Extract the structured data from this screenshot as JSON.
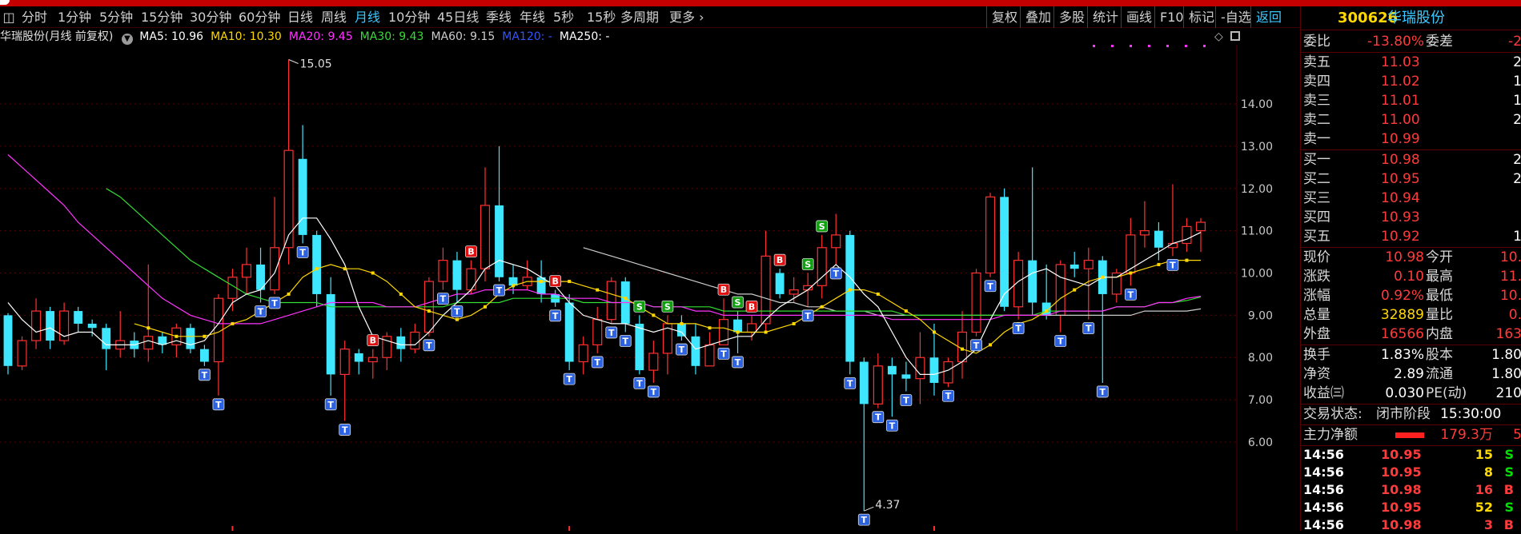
{
  "toolbar": {
    "tabs": [
      {
        "label": "分时",
        "active": false
      },
      {
        "label": "1分钟",
        "active": false
      },
      {
        "label": "5分钟",
        "active": false
      },
      {
        "label": "15分钟",
        "active": false
      },
      {
        "label": "30分钟",
        "active": false
      },
      {
        "label": "60分钟",
        "active": false
      },
      {
        "label": "日线",
        "active": false
      },
      {
        "label": "周线",
        "active": false
      },
      {
        "label": "月线",
        "active": true
      },
      {
        "label": "10分钟",
        "active": false
      },
      {
        "label": "45日线",
        "active": false
      },
      {
        "label": "季线",
        "active": false
      },
      {
        "label": "年线",
        "active": false
      },
      {
        "label": "5秒",
        "active": false
      },
      {
        "label": "15秒",
        "active": false
      },
      {
        "label": "多周期",
        "active": false
      },
      {
        "label": "更多",
        "active": false
      }
    ],
    "right_buttons": [
      "复权",
      "叠加",
      "多股",
      "统计",
      "画线",
      "F10",
      "标记",
      "-自选",
      "返回"
    ]
  },
  "ma_legend": {
    "title": "华瑞股份(月线 前复权)",
    "items": [
      {
        "label": "MA5: 10.96",
        "color": "#ffffff"
      },
      {
        "label": "MA10: 10.30",
        "color": "#ffd800"
      },
      {
        "label": "MA20: 9.45",
        "color": "#ff33ff"
      },
      {
        "label": "MA30: 9.43",
        "color": "#33dd33"
      },
      {
        "label": "MA60: 9.15",
        "color": "#cccccc"
      },
      {
        "label": "MA120: -",
        "color": "#3355ff"
      },
      {
        "label": "MA250: -",
        "color": "#ffffff"
      }
    ]
  },
  "chart_data": {
    "type": "candlestick",
    "ylim": [
      3.9,
      15.4
    ],
    "y_ticks": [
      "14.00",
      "13.00",
      "12.00",
      "11.00",
      "10.00",
      "9.00",
      "8.00",
      "7.00",
      "6.00"
    ],
    "y_tick_values": [
      14,
      13,
      12,
      11,
      10,
      9,
      8,
      7,
      6
    ],
    "high_label": "15.05",
    "high_value": 15.05,
    "high_index": 20,
    "low_label": "4.37",
    "low_value": 4.37,
    "low_index": 61,
    "colors": {
      "up": "#ff3030",
      "down": "#3fe6ff",
      "ma5": "#ffffff",
      "ma10": "#ffd800",
      "ma20": "#ff33ff",
      "ma30": "#33dd33",
      "ma60": "#cccccc",
      "t_marker": "#2d63e0",
      "b_marker": "#e01010",
      "s_marker": "#10a010"
    },
    "candles": [
      [
        9.0,
        7.8,
        9.05,
        7.6
      ],
      [
        7.8,
        8.4,
        8.5,
        7.7
      ],
      [
        8.4,
        9.1,
        9.4,
        8.2
      ],
      [
        9.1,
        8.4,
        9.2,
        8.2
      ],
      [
        8.4,
        9.1,
        9.3,
        8.3
      ],
      [
        9.1,
        8.8,
        9.2,
        8.6
      ],
      [
        8.8,
        8.7,
        8.9,
        8.5
      ],
      [
        8.7,
        8.2,
        8.8,
        7.7
      ],
      [
        8.2,
        8.4,
        9.1,
        8.0
      ],
      [
        8.4,
        8.2,
        8.6,
        8.0
      ],
      [
        8.2,
        8.5,
        10.2,
        7.9
      ],
      [
        8.5,
        8.3,
        8.6,
        8.1
      ],
      [
        8.3,
        8.7,
        8.8,
        8.0
      ],
      [
        8.7,
        8.2,
        8.8,
        8.1
      ],
      [
        8.2,
        7.9,
        8.3,
        7.8
      ],
      [
        7.9,
        9.4,
        9.5,
        7.1
      ],
      [
        9.4,
        9.9,
        10.1,
        9.1
      ],
      [
        9.9,
        10.2,
        10.6,
        9.5
      ],
      [
        10.2,
        9.6,
        10.6,
        9.3
      ],
      [
        9.6,
        10.6,
        11.8,
        9.5
      ],
      [
        10.6,
        12.9,
        15.05,
        10.2
      ],
      [
        12.7,
        10.9,
        13.5,
        10.7
      ],
      [
        10.9,
        9.5,
        11.0,
        9.2
      ],
      [
        9.5,
        7.6,
        9.9,
        7.1
      ],
      [
        7.6,
        8.2,
        8.4,
        6.5
      ],
      [
        8.1,
        7.9,
        8.2,
        7.6
      ],
      [
        7.9,
        8.0,
        8.2,
        7.5
      ],
      [
        8.0,
        8.5,
        8.6,
        7.7
      ],
      [
        8.5,
        8.2,
        8.7,
        7.9
      ],
      [
        8.2,
        8.6,
        8.8,
        8.1
      ],
      [
        8.6,
        9.8,
        9.9,
        8.5
      ],
      [
        9.8,
        10.3,
        10.6,
        9.6
      ],
      [
        10.3,
        9.6,
        10.5,
        9.3
      ],
      [
        9.6,
        10.1,
        10.3,
        9.5
      ],
      [
        10.1,
        11.6,
        12.5,
        9.8
      ],
      [
        11.6,
        9.9,
        13.0,
        9.8
      ],
      [
        9.9,
        9.7,
        10.2,
        9.5
      ],
      [
        9.7,
        9.9,
        10.3,
        9.6
      ],
      [
        9.9,
        9.5,
        10.3,
        9.3
      ],
      [
        9.5,
        9.3,
        9.6,
        9.2
      ],
      [
        9.3,
        7.9,
        9.5,
        7.7
      ],
      [
        7.9,
        8.3,
        8.5,
        7.6
      ],
      [
        8.3,
        8.9,
        9.2,
        8.1
      ],
      [
        8.9,
        9.8,
        9.9,
        8.8
      ],
      [
        9.8,
        8.8,
        9.9,
        8.6
      ],
      [
        8.8,
        7.7,
        9.0,
        7.6
      ],
      [
        7.7,
        8.1,
        8.4,
        7.4
      ],
      [
        8.1,
        8.8,
        9.0,
        7.6
      ],
      [
        8.8,
        8.5,
        9.0,
        8.4
      ],
      [
        8.5,
        7.8,
        8.8,
        7.6
      ],
      [
        7.8,
        8.3,
        8.6,
        7.8
      ],
      [
        8.3,
        8.9,
        9.4,
        8.3
      ],
      [
        8.9,
        8.6,
        9.1,
        8.1
      ],
      [
        8.6,
        8.8,
        9.0,
        8.4
      ],
      [
        8.8,
        10.4,
        11.0,
        8.6
      ],
      [
        10.0,
        9.5,
        10.1,
        9.4
      ],
      [
        9.5,
        9.6,
        9.9,
        9.3
      ],
      [
        9.6,
        9.7,
        10.0,
        9.2
      ],
      [
        9.7,
        10.6,
        10.9,
        9.4
      ],
      [
        10.6,
        10.9,
        11.4,
        10.2
      ],
      [
        10.9,
        7.9,
        11.0,
        7.6
      ],
      [
        7.9,
        6.9,
        8.0,
        4.37
      ],
      [
        6.9,
        7.8,
        8.1,
        6.8
      ],
      [
        7.8,
        7.6,
        8.0,
        6.6
      ],
      [
        7.6,
        7.5,
        7.9,
        7.2
      ],
      [
        7.5,
        8.0,
        8.6,
        6.9
      ],
      [
        8.0,
        7.4,
        8.8,
        7.1
      ],
      [
        7.4,
        7.9,
        8.0,
        7.3
      ],
      [
        7.9,
        8.6,
        9.1,
        7.5
      ],
      [
        8.6,
        10.0,
        10.1,
        8.5
      ],
      [
        10.0,
        11.8,
        11.9,
        9.9
      ],
      [
        11.8,
        9.2,
        12.0,
        9.1
      ],
      [
        9.2,
        10.3,
        10.5,
        8.9
      ],
      [
        10.3,
        9.3,
        12.5,
        9.0
      ],
      [
        9.3,
        9.0,
        10.2,
        8.9
      ],
      [
        9.0,
        10.2,
        10.3,
        8.6
      ],
      [
        10.2,
        10.1,
        10.5,
        9.9
      ],
      [
        10.1,
        10.3,
        10.6,
        8.9
      ],
      [
        10.3,
        9.5,
        10.4,
        7.4
      ],
      [
        9.5,
        10.0,
        10.1,
        9.3
      ],
      [
        10.0,
        10.9,
        11.3,
        9.7
      ],
      [
        10.9,
        11.0,
        11.7,
        10.6
      ],
      [
        11.0,
        10.6,
        11.2,
        10.3
      ],
      [
        10.6,
        10.7,
        12.1,
        10.4
      ],
      [
        10.7,
        11.1,
        11.3,
        10.5
      ],
      [
        11.0,
        11.2,
        11.3,
        10.5
      ]
    ],
    "ma5": [
      9.3,
      8.9,
      8.6,
      8.7,
      8.5,
      8.6,
      8.6,
      8.3,
      8.3,
      8.3,
      8.4,
      8.3,
      8.4,
      8.3,
      8.4,
      8.8,
      9.3,
      9.5,
      9.6,
      10.0,
      10.9,
      11.3,
      11.3,
      10.8,
      10.2,
      9.2,
      8.5,
      8.4,
      8.3,
      8.3,
      8.6,
      9.0,
      9.3,
      9.6,
      10.1,
      10.3,
      10.2,
      10.1,
      9.9,
      9.7,
      9.3,
      9.0,
      8.9,
      8.8,
      8.8,
      8.7,
      8.6,
      8.7,
      8.6,
      8.2,
      8.3,
      8.4,
      8.5,
      8.5,
      8.9,
      9.2,
      9.4,
      9.6,
      9.9,
      10.2,
      9.9,
      9.5,
      9.2,
      8.6,
      8.0,
      7.6,
      7.6,
      7.7,
      7.9,
      8.2,
      8.9,
      9.5,
      9.8,
      10.0,
      10.1,
      9.9,
      9.8,
      9.7,
      9.9,
      9.9,
      10.1,
      10.3,
      10.5,
      10.7,
      10.8,
      10.96
    ],
    "ma10": [
      null,
      null,
      null,
      null,
      null,
      null,
      null,
      null,
      null,
      8.8,
      8.7,
      8.6,
      8.5,
      8.5,
      8.5,
      8.6,
      8.8,
      8.9,
      9.1,
      9.3,
      9.5,
      9.9,
      10.1,
      10.2,
      10.1,
      10.1,
      10.0,
      9.8,
      9.5,
      9.2,
      9.1,
      9.0,
      8.9,
      9.0,
      9.2,
      9.5,
      9.7,
      9.8,
      9.8,
      9.8,
      9.8,
      9.7,
      9.6,
      9.5,
      9.4,
      9.2,
      9.0,
      8.8,
      8.8,
      8.8,
      8.7,
      8.7,
      8.6,
      8.6,
      8.6,
      8.7,
      8.8,
      9.0,
      9.2,
      9.4,
      9.6,
      9.6,
      9.5,
      9.3,
      9.1,
      8.9,
      8.6,
      8.4,
      8.2,
      8.1,
      8.3,
      8.6,
      8.8,
      8.9,
      9.1,
      9.4,
      9.6,
      9.8,
      9.9,
      9.9,
      10.0,
      10.1,
      10.2,
      10.3,
      10.3,
      10.3
    ],
    "ma20": [
      12.8,
      12.5,
      12.2,
      11.9,
      11.6,
      11.2,
      10.9,
      10.6,
      10.3,
      10.0,
      9.7,
      9.4,
      9.2,
      9.0,
      8.9,
      8.8,
      8.8,
      8.8,
      8.8,
      8.9,
      9.0,
      9.1,
      9.2,
      9.3,
      9.3,
      9.3,
      9.3,
      9.2,
      9.2,
      9.2,
      9.3,
      9.4,
      9.5,
      9.5,
      9.6,
      9.6,
      9.6,
      9.6,
      9.5,
      9.5,
      9.4,
      9.4,
      9.4,
      9.3,
      9.3,
      9.3,
      9.2,
      9.2,
      9.2,
      9.1,
      9.1,
      9.0,
      9.0,
      9.0,
      9.0,
      9.0,
      9.0,
      9.0,
      9.0,
      9.0,
      9.0,
      9.0,
      9.0,
      8.9,
      8.9,
      8.9,
      8.9,
      8.9,
      8.9,
      8.9,
      8.9,
      9.0,
      9.0,
      9.0,
      9.0,
      9.1,
      9.1,
      9.1,
      9.1,
      9.2,
      9.2,
      9.2,
      9.3,
      9.3,
      9.4,
      9.45
    ],
    "ma30": [
      null,
      null,
      null,
      null,
      null,
      null,
      null,
      12.0,
      11.8,
      11.5,
      11.2,
      10.9,
      10.6,
      10.3,
      10.1,
      9.9,
      9.7,
      9.5,
      9.4,
      9.3,
      9.3,
      9.3,
      9.3,
      9.2,
      9.2,
      9.2,
      9.2,
      9.2,
      9.2,
      9.2,
      9.2,
      9.2,
      9.3,
      9.3,
      9.3,
      9.3,
      9.4,
      9.4,
      9.4,
      9.4,
      9.4,
      9.3,
      9.3,
      9.3,
      9.3,
      9.3,
      9.2,
      9.2,
      9.2,
      9.2,
      9.2,
      9.1,
      9.1,
      9.1,
      9.1,
      9.1,
      9.1,
      9.1,
      9.1,
      9.1,
      9.1,
      9.1,
      9.1,
      9.1,
      9.0,
      9.0,
      9.0,
      9.0,
      9.0,
      9.0,
      9.0,
      9.0,
      9.0,
      9.0,
      9.1,
      9.1,
      9.1,
      9.1,
      9.1,
      9.2,
      9.2,
      9.2,
      9.3,
      9.3,
      9.35,
      9.43
    ],
    "ma60": [
      null,
      null,
      null,
      null,
      null,
      null,
      null,
      null,
      null,
      null,
      null,
      null,
      null,
      null,
      null,
      null,
      null,
      null,
      null,
      null,
      null,
      null,
      null,
      null,
      null,
      null,
      null,
      null,
      null,
      null,
      null,
      null,
      null,
      null,
      null,
      null,
      null,
      null,
      null,
      null,
      null,
      10.6,
      10.5,
      10.4,
      10.3,
      10.2,
      10.1,
      10.0,
      9.9,
      9.8,
      9.7,
      9.6,
      9.5,
      9.5,
      9.4,
      9.3,
      9.3,
      9.2,
      9.2,
      9.1,
      9.1,
      9.1,
      9.0,
      9.0,
      9.0,
      9.0,
      9.0,
      9.0,
      9.0,
      9.0,
      9.0,
      9.0,
      9.0,
      9.0,
      9.0,
      9.0,
      9.0,
      9.0,
      9.0,
      9.0,
      9.0,
      9.1,
      9.1,
      9.1,
      9.1,
      9.15
    ],
    "t_markers": [
      14,
      15,
      18,
      19,
      21,
      23,
      24,
      30,
      31,
      32,
      35,
      39,
      40,
      42,
      43,
      44,
      45,
      46,
      48,
      51,
      52,
      57,
      59,
      60,
      61,
      62,
      63,
      64,
      67,
      69,
      70,
      72,
      75,
      77,
      78,
      80,
      83
    ],
    "b_markers": [
      [
        33,
        "B"
      ],
      [
        26,
        "B"
      ],
      [
        39,
        "B"
      ],
      [
        51,
        "B"
      ],
      [
        53,
        "B"
      ],
      [
        55,
        "B"
      ]
    ],
    "s_markers": [
      [
        45,
        "S"
      ],
      [
        47,
        "S"
      ],
      [
        52,
        "S"
      ],
      [
        57,
        "S"
      ],
      [
        58,
        "S"
      ]
    ],
    "bottom_marks": [
      16,
      40,
      66
    ]
  },
  "quote": {
    "code": "300626",
    "name": "华瑞股份",
    "weibi": {
      "label": "委比",
      "value": "-13.80%",
      "label2": "委差",
      "value2": "-2"
    },
    "sells": [
      {
        "label": "卖五",
        "price": "11.03",
        "vol": "2"
      },
      {
        "label": "卖四",
        "price": "11.02",
        "vol": "1"
      },
      {
        "label": "卖三",
        "price": "11.01",
        "vol": "1"
      },
      {
        "label": "卖二",
        "price": "11.00",
        "vol": "2"
      },
      {
        "label": "卖一",
        "price": "10.99",
        "vol": ""
      }
    ],
    "buys": [
      {
        "label": "买一",
        "price": "10.98",
        "vol": "2"
      },
      {
        "label": "买二",
        "price": "10.95",
        "vol": "2"
      },
      {
        "label": "买三",
        "price": "10.94",
        "vol": ""
      },
      {
        "label": "买四",
        "price": "10.93",
        "vol": ""
      },
      {
        "label": "买五",
        "price": "10.92",
        "vol": "1"
      }
    ],
    "stats": [
      {
        "l1": "现价",
        "v1": "10.98",
        "c1": "red",
        "l2": "今开",
        "v2": "10."
      },
      {
        "l1": "涨跌",
        "v1": "0.10",
        "c1": "red",
        "l2": "最高",
        "v2": "11."
      },
      {
        "l1": "涨幅",
        "v1": "0.92%",
        "c1": "red",
        "l2": "最低",
        "v2": "10."
      },
      {
        "l1": "总量",
        "v1": "32889",
        "c1": "yel",
        "l2": "量比",
        "v2": "0."
      },
      {
        "l1": "外盘",
        "v1": "16566",
        "c1": "red",
        "l2": "内盘",
        "v2": "163"
      }
    ],
    "stats2": [
      {
        "l1": "换手",
        "v1": "1.83%",
        "l2": "股本",
        "v2": "1.80"
      },
      {
        "l1": "净资",
        "v1": "2.89",
        "l2": "流通",
        "v2": "1.80"
      },
      {
        "l1": "收益㈢",
        "v1": "0.030",
        "l2": "PE(动)",
        "v2": "210"
      }
    ],
    "trade_status": {
      "label": "交易状态:",
      "value": "闭市阶段",
      "time": "15:30:00"
    },
    "main_flow": {
      "label": "主力净额",
      "value": "179.3万",
      "extra": "5"
    },
    "ticks": [
      {
        "time": "14:56",
        "price": "10.95",
        "vol": "15",
        "side": "S"
      },
      {
        "time": "14:56",
        "price": "10.95",
        "vol": "8",
        "side": "S"
      },
      {
        "time": "14:56",
        "price": "10.98",
        "vol": "16",
        "side": "B"
      },
      {
        "time": "14:56",
        "price": "10.95",
        "vol": "52",
        "side": "S"
      },
      {
        "time": "14:56",
        "price": "10.98",
        "vol": "3",
        "side": "B"
      }
    ]
  }
}
